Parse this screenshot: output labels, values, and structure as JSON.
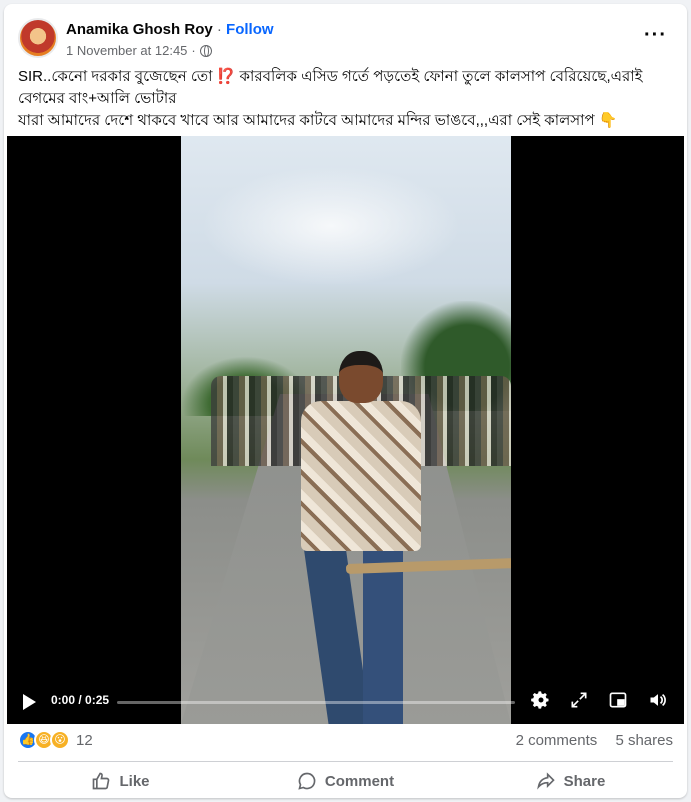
{
  "post": {
    "author": "Anamika Ghosh Roy",
    "separator": "·",
    "follow_label": "Follow",
    "timestamp": "1 November at 12:45",
    "audience_icon": "globe-icon",
    "more_icon": "more-options-icon",
    "caption": "SIR..কেনো দরকার বুজেছেন তো ⁉️ কারবলিক এসিড গর্তে পড়তেই ফোনা তুলে কালসাপ বেরিয়েছে,এরাই বেগমের বাং+আলি ভোটার\nযারা আমাদের দেশে থাকবে খাবে আর আমাদের  কাটবে আমাদের মন্দির ভাঙবে,,,এরা সেই কালসাপ 👇"
  },
  "video": {
    "time": "0:00 / 0:25",
    "progress": 0.0,
    "controls": [
      "play-icon",
      "settings-icon",
      "fullscreen-icon",
      "pip-icon",
      "volume-icon"
    ]
  },
  "stats": {
    "reaction_count": "12",
    "reactions": [
      "like-reaction-icon",
      "haha-reaction-icon",
      "wow-reaction-icon"
    ],
    "comments": "2 comments",
    "shares": "5 shares"
  },
  "actions": {
    "like": "Like",
    "comment": "Comment",
    "share": "Share"
  },
  "colors": {
    "accent": "#0866ff",
    "secondary_text": "#65676b",
    "background": "#f0f2f5"
  }
}
